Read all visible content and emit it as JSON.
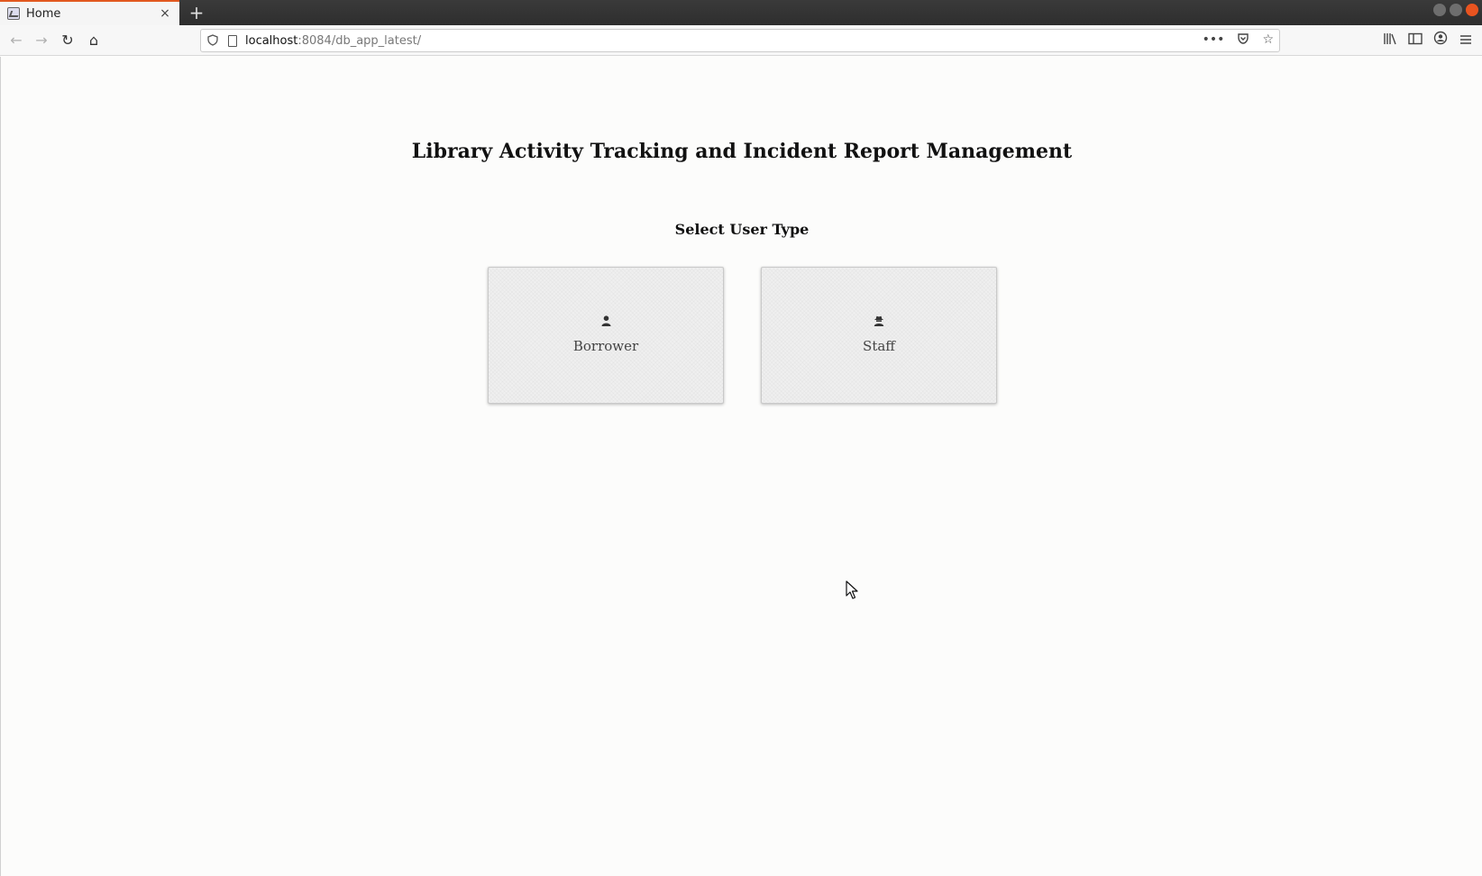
{
  "browser": {
    "tab": {
      "title": "Home",
      "close_glyph": "×"
    },
    "new_tab_glyph": "+",
    "nav": {
      "back_icon": "←",
      "forward_icon": "→",
      "reload_icon": "↻",
      "home_icon": "⌂"
    },
    "url": {
      "host": "localhost",
      "path": ":8084/db_app_latest/",
      "actions_glyph": "•••",
      "pocket_icon": "◡",
      "bookmark_icon": "☆"
    },
    "toolbar": {
      "library_icon": "|||\\",
      "sidebar_icon": "▯",
      "account_icon": "◉",
      "menu_icon": "≡"
    }
  },
  "page": {
    "title": "Library Activity Tracking and Incident Report Management",
    "section_title": "Select User Type",
    "cards": [
      {
        "label": "Borrower",
        "icon": "user-icon"
      },
      {
        "label": "Staff",
        "icon": "user-secret-icon"
      }
    ]
  },
  "colors": {
    "accent_tab": "#e25920",
    "background": "#fcfcfb",
    "card_bg": "#efefef"
  }
}
